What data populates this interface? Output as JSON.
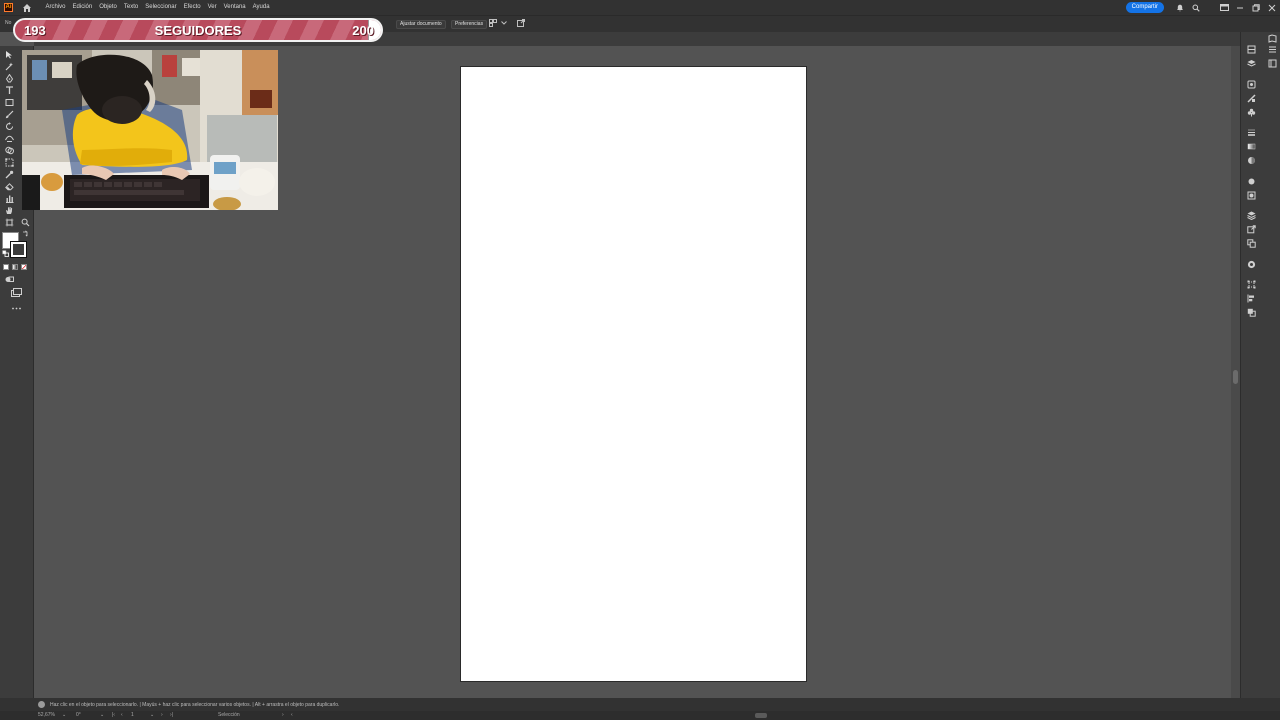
{
  "menubar": {
    "app_logo_text": "Ai",
    "items": [
      "Archivo",
      "Edición",
      "Objeto",
      "Texto",
      "Seleccionar",
      "Efecto",
      "Ver",
      "Ventana",
      "Ayuda"
    ],
    "share_label": "Compartir",
    "icons": [
      "home-icon",
      "bell-icon",
      "search-icon",
      "arrange-icon",
      "minimize-icon",
      "restore-icon",
      "close-icon"
    ]
  },
  "controlbar": {
    "left_label": "No",
    "adjust_document": "Ajustar documento",
    "preferences": "Preferencias"
  },
  "overlay": {
    "followers_current": "193",
    "followers_label": "SEGUIDORES",
    "followers_goal": "200",
    "followers_progress": 0.965,
    "bar_colors": [
      "#b84a5c",
      "#c8697a"
    ]
  },
  "hintbar": {
    "text": "Haz clic en el objeto para seleccionarlo.  |  Mayús + haz clic para seleccionar varios objetos.  |  Alt + arrastra el objeto para duplicarlo."
  },
  "statusbar": {
    "zoom": "52,67%",
    "rotation": "0°",
    "artboard_number": "1",
    "tool_name": "Selección"
  },
  "colors": {
    "accent": "#1473e6",
    "workspace": "#535353",
    "panel": "#3c3c3c",
    "chrome": "#323232",
    "artboard": "#ffffff"
  }
}
